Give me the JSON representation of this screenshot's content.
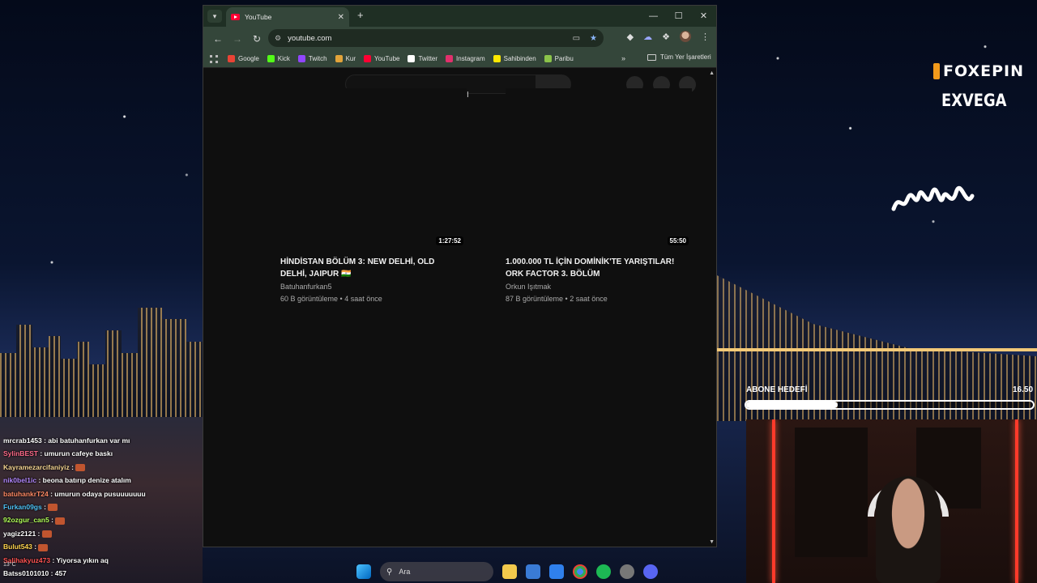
{
  "browser": {
    "tab_title": "YouTube",
    "url": "youtube.com",
    "bookmarks": [
      {
        "label": "Google",
        "color": "#ea4335"
      },
      {
        "label": "Kick",
        "color": "#53fc18"
      },
      {
        "label": "Twitch",
        "color": "#9146ff"
      },
      {
        "label": "Kur",
        "color": "#e2a33a"
      },
      {
        "label": "YouTube",
        "color": "#ff0033"
      },
      {
        "label": "Twitter",
        "color": "#ffffff"
      },
      {
        "label": "Instagram",
        "color": "#e1306c"
      },
      {
        "label": "Sahibinden",
        "color": "#ffe800"
      },
      {
        "label": "Paribu",
        "color": "#8bc34a"
      }
    ],
    "bookmarks_folder": "Tüm Yer İşaretleri"
  },
  "videos": [
    {
      "duration": "1:27:52",
      "title": "HİNDİSTAN BÖLÜM 3: NEW DELHİ, OLD DELHİ, JAIPUR 🇮🇳",
      "channel": "Batuhanfurkan5",
      "meta": "60 B görüntüleme • 4 saat önce"
    },
    {
      "duration": "55:50",
      "title": "1.000.000 TL İÇİN DOMİNİK'TE YARIŞTILAR! ORK FACTOR 3. BÖLÜM",
      "channel": "Orkun Işıtmak",
      "meta": "87 B görüntüleme • 2 saat önce"
    }
  ],
  "overlay": {
    "sponsor1": "FOXEPIN",
    "sponsor2": "EXVEGA",
    "goal_label": "ABONE HEDEFİ",
    "goal_value": "16.50",
    "goal_progress": 0.32
  },
  "chat": [
    {
      "user": "mrcrab1453",
      "color": "#ffffff",
      "msg": " : abi batuhanfurkan var mı"
    },
    {
      "user": "SylinBEST",
      "color": "#ff6b8a",
      "msg": " : umurun cafeye baskı"
    },
    {
      "user": "Kayramezarcifaniyiz",
      "color": "#f7d794",
      "msg": " : "
    },
    {
      "user": "nik0bel1ic",
      "color": "#b388ff",
      "msg": " : beona batırıp denize atalım"
    },
    {
      "user": "batuhankrT24",
      "color": "#ff8a65",
      "msg": " : umurun odaya pusuuuuuuu"
    },
    {
      "user": "Furkan09gs",
      "color": "#4fc3f7",
      "msg": " : "
    },
    {
      "user": "92ozgur_can5",
      "color": "#b2ff59",
      "msg": " : "
    },
    {
      "user": "yagiz2121",
      "color": "#ffffff",
      "msg": " : "
    },
    {
      "user": "Bulut543",
      "color": "#ffd54f",
      "msg": " : "
    },
    {
      "user": "Salihakyuz473",
      "color": "#ff5252",
      "msg": " : Yiyorsa yıkın aq"
    },
    {
      "user": "Batss0101010",
      "color": "#ffffff",
      "msg": " : 457"
    }
  ],
  "taskbar": {
    "search_label": "Ara",
    "weather": "13°C"
  }
}
